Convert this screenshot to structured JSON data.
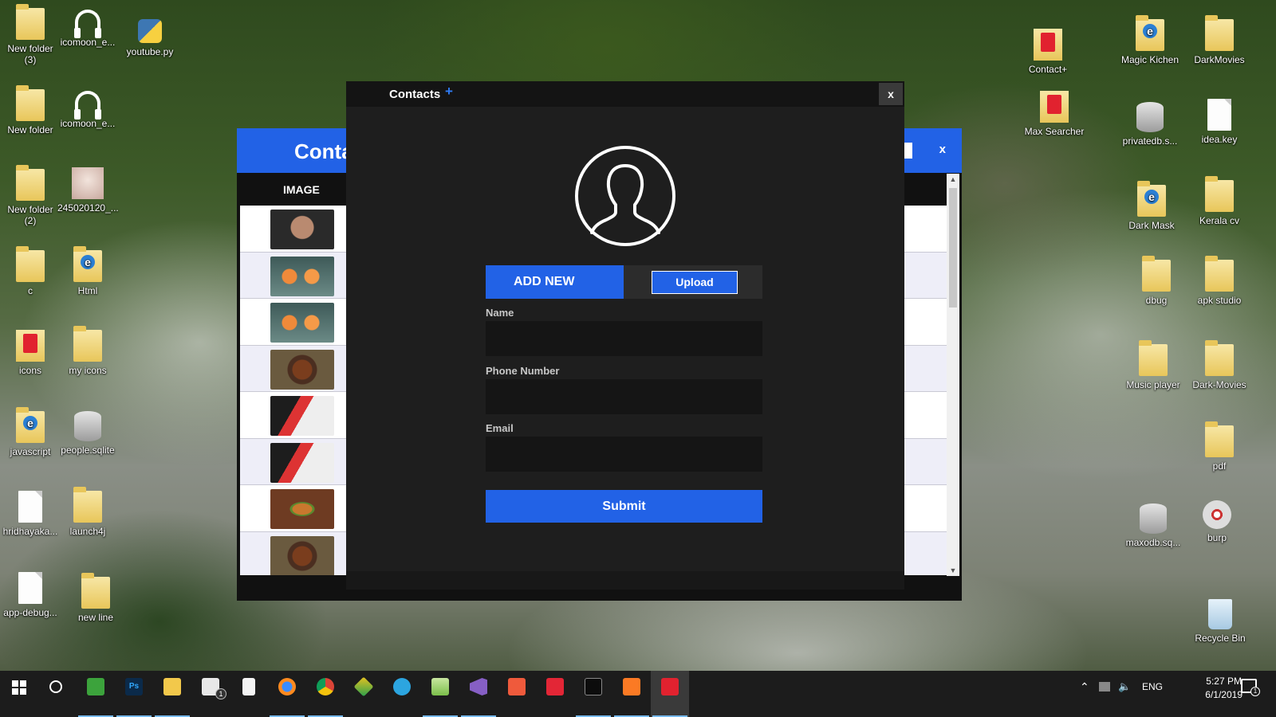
{
  "desktop_left": [
    {
      "label": "New folder\n(3)",
      "icon": "folder"
    },
    {
      "label": "icomoon_e...",
      "icon": "headphone"
    },
    {
      "label": "youtube.py",
      "icon": "python"
    },
    {
      "label": "New folder",
      "icon": "folder"
    },
    {
      "label": "icomoon_e...",
      "icon": "headphone"
    },
    {
      "label": "New folder\n(2)",
      "icon": "folder"
    },
    {
      "label": "245020120_...",
      "icon": "photo"
    },
    {
      "label": "c",
      "icon": "folder"
    },
    {
      "label": "Html",
      "icon": "folder-e"
    },
    {
      "label": "icons",
      "icon": "red"
    },
    {
      "label": "my icons",
      "icon": "folder"
    },
    {
      "label": "javascript",
      "icon": "folder-e"
    },
    {
      "label": "people.sqlite",
      "icon": "db"
    },
    {
      "label": "hridhayaka...",
      "icon": "file"
    },
    {
      "label": "launch4j",
      "icon": "folder"
    },
    {
      "label": "app-debug...",
      "icon": "file"
    },
    {
      "label": "new line",
      "icon": "folder"
    }
  ],
  "desktop_right": [
    {
      "label": "Contact+",
      "icon": "red"
    },
    {
      "label": "Magic Kichen",
      "icon": "folder-e"
    },
    {
      "label": "DarkMovies",
      "icon": "folder"
    },
    {
      "label": "Max Searcher",
      "icon": "red"
    },
    {
      "label": "privatedb.s...",
      "icon": "db"
    },
    {
      "label": "idea.key",
      "icon": "file"
    },
    {
      "label": "Dark Mask",
      "icon": "folder-e"
    },
    {
      "label": "Kerala cv",
      "icon": "folder"
    },
    {
      "label": "dbug",
      "icon": "folder"
    },
    {
      "label": "apk studio",
      "icon": "folder"
    },
    {
      "label": "Music player",
      "icon": "folder"
    },
    {
      "label": "Dark-Movies",
      "icon": "folder"
    },
    {
      "label": "pdf",
      "icon": "folder"
    },
    {
      "label": "maxodb.sq...",
      "icon": "db"
    },
    {
      "label": "burp",
      "icon": "disc"
    },
    {
      "label": "Recycle Bin",
      "icon": "bin"
    }
  ],
  "bg_window": {
    "title": "Conta",
    "close": "x",
    "column_header": "IMAGE",
    "rows": [
      "thumb-face",
      "thumb-shrimp",
      "thumb-shrimp",
      "thumb-bowl",
      "thumb-chef",
      "thumb-chef",
      "thumb-burger",
      "thumb-bowl"
    ]
  },
  "modal": {
    "title": "Contacts",
    "plus": "+",
    "close": "x",
    "tab_add_new": "ADD NEW",
    "upload": "Upload",
    "name_label": "Name",
    "name_value": "",
    "phone_label": "Phone Number",
    "phone_value": "",
    "email_label": "Email",
    "email_value": "",
    "submit": "Submit"
  },
  "taskbar": {
    "apps": [
      "start",
      "cortana",
      "camtasia",
      "photoshop",
      "file-explorer",
      "mail",
      "notepad",
      "firefox",
      "chrome",
      "sketchup",
      "telegram",
      "notepad-plus",
      "visual-studio",
      "recorder",
      "search-tool",
      "terminal",
      "xampp",
      "contact-app"
    ],
    "mail_badge": "1",
    "language": "ENG",
    "time": "5:27 PM",
    "date": "6/1/2019",
    "notification_count": "1"
  },
  "colors": {
    "accent": "#2262e6",
    "modal_bg": "#1e1e1e",
    "taskbar_bg": "#1c1c1c"
  }
}
